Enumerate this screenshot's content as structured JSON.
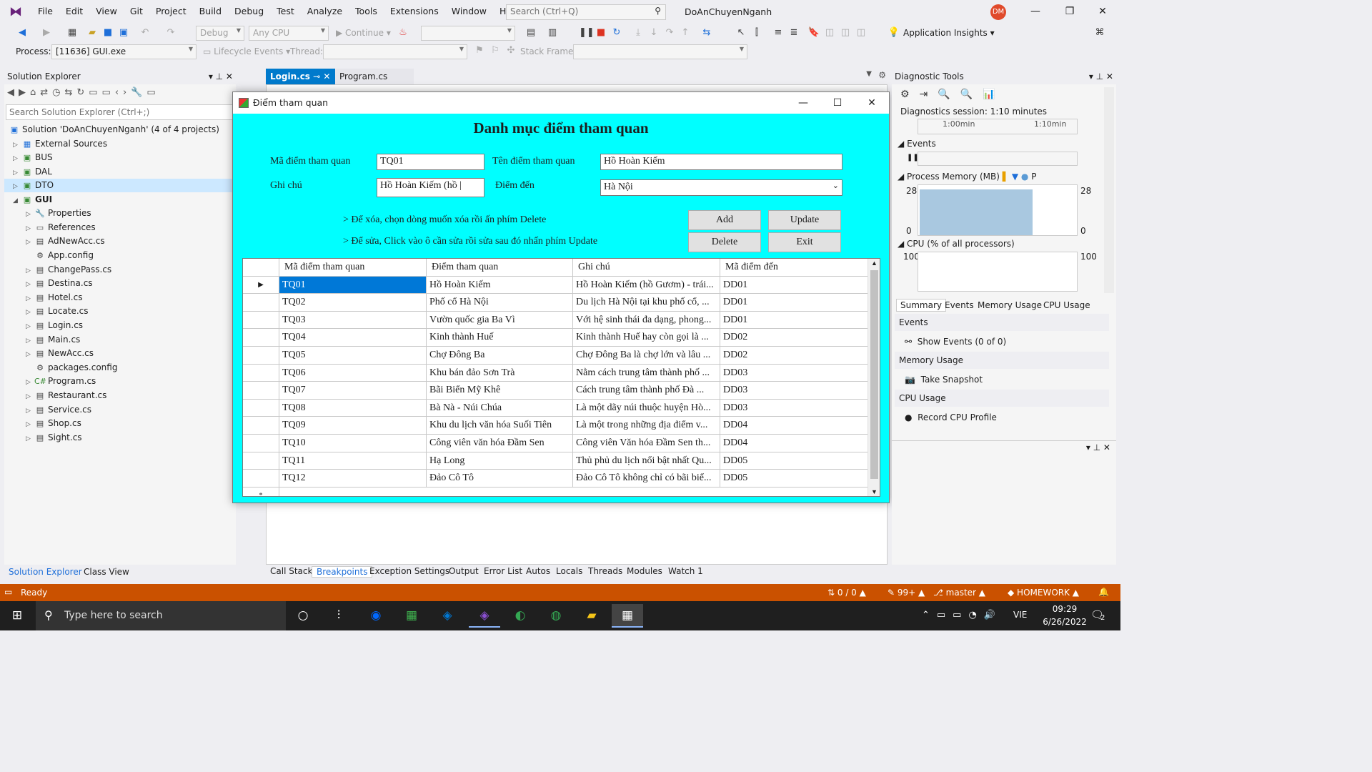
{
  "menubar": {
    "items": [
      "File",
      "Edit",
      "View",
      "Git",
      "Project",
      "Build",
      "Debug",
      "Test",
      "Analyze",
      "Tools",
      "Extensions",
      "Window",
      "Help"
    ],
    "search_placeholder": "Search (Ctrl+Q)",
    "solution_name": "DoAnChuyenNganh",
    "avatar_initials": "DM"
  },
  "toolbar": {
    "config": "Debug",
    "platform": "Any CPU",
    "continue_label": "Continue",
    "app_insights": "Application Insights",
    "process_label": "Process:",
    "process_value": "[11636] GUI.exe",
    "lifecycle_label": "Lifecycle Events",
    "thread_label": "Thread:",
    "stackframe_label": "Stack Frame:"
  },
  "solution_explorer": {
    "title": "Solution Explorer",
    "search_placeholder": "Search Solution Explorer (Ctrl+;)",
    "solution_node": "Solution 'DoAnChuyenNganh' (4 of 4 projects)",
    "items": [
      {
        "label": "External Sources",
        "icon": "external-sources-icon"
      },
      {
        "label": "BUS",
        "icon": "csharp-project-icon"
      },
      {
        "label": "DAL",
        "icon": "csharp-project-icon"
      },
      {
        "label": "DTO",
        "icon": "csharp-project-icon"
      },
      {
        "label": "GUI",
        "icon": "csharp-project-icon"
      },
      {
        "label": "Properties",
        "icon": "wrench-icon"
      },
      {
        "label": "References",
        "icon": "references-icon"
      },
      {
        "label": "AdNewAcc.cs",
        "icon": "form-icon"
      },
      {
        "label": "App.config",
        "icon": "config-icon"
      },
      {
        "label": "ChangePass.cs",
        "icon": "form-icon"
      },
      {
        "label": "Destina.cs",
        "icon": "form-icon"
      },
      {
        "label": "Hotel.cs",
        "icon": "form-icon"
      },
      {
        "label": "Locate.cs",
        "icon": "form-icon"
      },
      {
        "label": "Login.cs",
        "icon": "form-icon"
      },
      {
        "label": "Main.cs",
        "icon": "form-icon"
      },
      {
        "label": "NewAcc.cs",
        "icon": "form-icon"
      },
      {
        "label": "packages.config",
        "icon": "config-icon"
      },
      {
        "label": "Program.cs",
        "icon": "csharp-file-icon"
      },
      {
        "label": "Restaurant.cs",
        "icon": "form-icon"
      },
      {
        "label": "Service.cs",
        "icon": "form-icon"
      },
      {
        "label": "Shop.cs",
        "icon": "form-icon"
      },
      {
        "label": "Sight.cs",
        "icon": "form-icon"
      }
    ],
    "bottom_tabs": [
      "Solution Explorer",
      "Class View"
    ]
  },
  "doc_tabs": [
    "Login.cs",
    "Program.cs"
  ],
  "form": {
    "window_title": "Điểm tham quan",
    "heading": "Danh mục điểm tham quan",
    "labels": {
      "ma_diem": "Mã điểm tham quan",
      "ten_diem": "Tên điểm tham quan",
      "ghi_chu": "Ghi chú",
      "diem_den": "Điểm đến"
    },
    "values": {
      "ma_diem": "TQ01",
      "ten_diem": "Hồ Hoàn Kiếm",
      "ghi_chu": "Hồ Hoàn Kiếm (hồ |",
      "diem_den": "Hà Nội"
    },
    "hints": [
      "> Để xóa, chọn dòng muốn xóa rồi ấn phím Delete",
      "> Để sửa, Click vào ô cần sửa rồi sửa sau đó nhấn phím Update"
    ],
    "buttons": {
      "add": "Add",
      "update": "Update",
      "delete": "Delete",
      "exit": "Exit"
    },
    "grid": {
      "columns": [
        "Mã điểm tham quan",
        "Điểm tham quan",
        "Ghi chú",
        "Mã điểm đến"
      ],
      "rows": [
        [
          "TQ01",
          "Hồ Hoàn Kiếm",
          "Hồ Hoàn Kiếm (hồ Gươm) - trái...",
          "DD01"
        ],
        [
          "TQ02",
          "Phố cổ Hà Nội",
          "Du lịch Hà Nội tại khu phố cổ, ...",
          "DD01"
        ],
        [
          "TQ03",
          "Vườn quốc gia Ba Vì",
          "Với hệ sinh thái đa dạng, phong...",
          "DD01"
        ],
        [
          "TQ04",
          "Kinh thành Huế",
          "Kinh thành Huế hay còn gọi là ...",
          "DD02"
        ],
        [
          "TQ05",
          "Chợ Đông Ba",
          "Chợ Đông Ba là chợ lớn và lâu ...",
          "DD02"
        ],
        [
          "TQ06",
          "Khu bán đảo Sơn Trà",
          "Nằm cách trung tâm thành phố ...",
          "DD03"
        ],
        [
          "TQ07",
          "Bãi Biển Mỹ Khê",
          "Cách trung tâm thành phố Đà ...",
          "DD03"
        ],
        [
          "TQ08",
          "Bà Nà - Núi Chúa",
          "Là một dãy núi thuộc huyện Hò...",
          "DD03"
        ],
        [
          "TQ09",
          "Khu du lịch văn hóa Suối Tiên",
          "Là một trong những địa điểm v...",
          "DD04"
        ],
        [
          "TQ10",
          "Công viên  văn hóa Đầm Sen",
          "Công viên Văn hóa Đầm Sen th...",
          "DD04"
        ],
        [
          "TQ11",
          "Hạ Long",
          "Thủ phủ du lịch nổi bật nhất Qu...",
          "DD05"
        ],
        [
          "TQ12",
          "Đảo Cô Tô",
          "Đảo Cô Tô không chỉ có bãi biể...",
          "DD05"
        ]
      ]
    }
  },
  "diagnostic_tools": {
    "title": "Diagnostic Tools",
    "session": "Diagnostics session: 1:10 minutes",
    "timeline_ticks": [
      "1:00min",
      "1:10min"
    ],
    "events_label": "Events",
    "memory_label": "Process Memory (MB)",
    "memory_max": "28",
    "memory_min": "0",
    "memory_legend": "P",
    "cpu_label": "CPU (% of all processors)",
    "cpu_max": "100",
    "tabs": [
      "Summary",
      "Events",
      "Memory Usage",
      "CPU Usage"
    ],
    "sections": [
      {
        "header": "Events",
        "action": "Show Events (0 of 0)"
      },
      {
        "header": "Memory Usage",
        "action": "Take Snapshot"
      },
      {
        "header": "CPU Usage",
        "action": "Record CPU Profile"
      }
    ]
  },
  "bottom_tabs": [
    "Call Stack",
    "Breakpoints",
    "Exception Settings",
    "Output",
    "Error List",
    "Autos",
    "Locals",
    "Threads",
    "Modules",
    "Watch 1"
  ],
  "statusbar": {
    "ready": "Ready",
    "lines": "0 / 0",
    "edits": "99+",
    "branch": "master",
    "repo": "HOMEWORK"
  },
  "taskbar": {
    "search_placeholder": "Type here to search",
    "language": "VIE",
    "time": "09:29",
    "date": "6/26/2022",
    "notifications": "2",
    "colors": {
      "statusbar": "#ca5100",
      "form_bg": "#00ffff",
      "selected_cell": "#0078d7"
    }
  }
}
